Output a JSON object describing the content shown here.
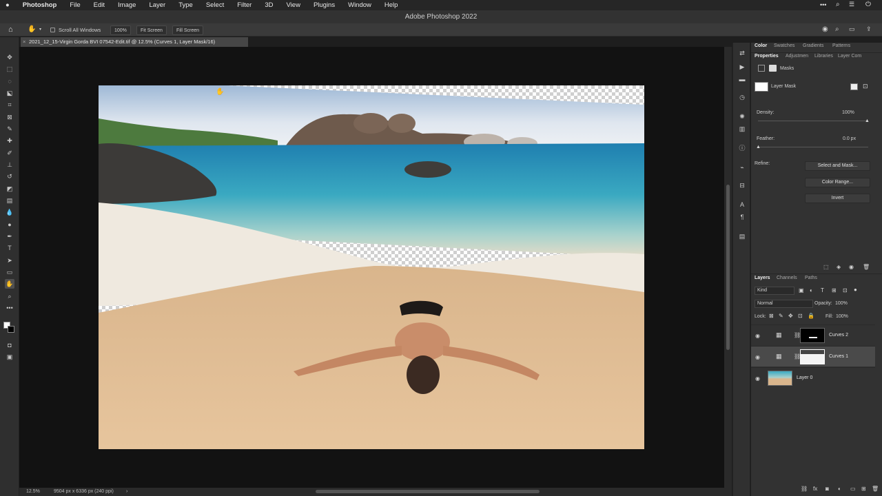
{
  "menu": {
    "app": "Photoshop",
    "items": [
      "File",
      "Edit",
      "Image",
      "Layer",
      "Type",
      "Select",
      "Filter",
      "3D",
      "View",
      "Plugins",
      "Window",
      "Help"
    ]
  },
  "window_title": "Adobe Photoshop 2022",
  "options_bar": {
    "scroll_all_windows": "Scroll All Windows",
    "zoom_100": "100%",
    "fit_screen": "Fit Screen",
    "fill_screen": "Fill Screen"
  },
  "document_tab": "2021_12_15-Virgin Gorda BVI 07542-Edit.tif @ 12.5% (Curves 1, Layer Mask/16)",
  "panel_tabs_top": [
    "Color",
    "Swatches",
    "Gradients",
    "Patterns"
  ],
  "panel_tabs_props": [
    "Properties",
    "Adjustmen",
    "Libraries",
    "Layer Com"
  ],
  "properties": {
    "masks_label": "Masks",
    "layer_mask_label": "Layer Mask",
    "density_label": "Density:",
    "density_value": "100%",
    "feather_label": "Feather:",
    "feather_value": "0.0 px",
    "refine_label": "Refine:",
    "select_and_mask": "Select and Mask...",
    "color_range": "Color Range...",
    "invert": "Invert"
  },
  "layers_panel": {
    "tabs": [
      "Layers",
      "Channels",
      "Paths"
    ],
    "kind_filter": "Kind",
    "blend_mode": "Normal",
    "opacity_label": "Opacity:",
    "opacity_value": "100%",
    "lock_label": "Lock:",
    "fill_label": "Fill:",
    "fill_value": "100%",
    "layers": [
      {
        "name": "Curves 2",
        "selected": false
      },
      {
        "name": "Curves 1",
        "selected": true
      },
      {
        "name": "Layer 0",
        "selected": false
      }
    ]
  },
  "status": {
    "zoom": "12.5%",
    "dimensions": "9504 px x 6336 px (240 ppi)"
  },
  "colors": {
    "accent": "#2f6ee0",
    "panel_bg": "#323232",
    "canvas_bg": "#121212"
  }
}
